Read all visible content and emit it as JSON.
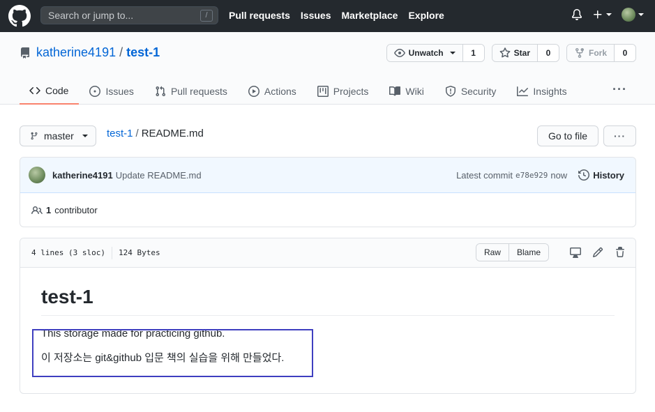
{
  "header": {
    "search_placeholder": "Search or jump to...",
    "search_shortcut": "/",
    "nav": [
      "Pull requests",
      "Issues",
      "Marketplace",
      "Explore"
    ]
  },
  "repo": {
    "owner": "katherine4191",
    "separator": "/",
    "name": "test-1",
    "watch": {
      "label": "Unwatch",
      "count": "1"
    },
    "star": {
      "label": "Star",
      "count": "0"
    },
    "fork": {
      "label": "Fork",
      "count": "0"
    },
    "tabs": [
      {
        "label": "Code",
        "icon": "code-icon",
        "selected": true
      },
      {
        "label": "Issues",
        "icon": "issue-icon"
      },
      {
        "label": "Pull requests",
        "icon": "pull-request-icon"
      },
      {
        "label": "Actions",
        "icon": "play-icon"
      },
      {
        "label": "Projects",
        "icon": "project-icon"
      },
      {
        "label": "Wiki",
        "icon": "book-icon"
      },
      {
        "label": "Security",
        "icon": "shield-icon"
      },
      {
        "label": "Insights",
        "icon": "graph-icon"
      }
    ]
  },
  "file_nav": {
    "branch": "master",
    "breadcrumb_repo": "test-1",
    "breadcrumb_sep": "/",
    "breadcrumb_file": "README.md",
    "goto_file": "Go to file",
    "more": "···"
  },
  "commit": {
    "author": "katherine4191",
    "message": "Update README.md",
    "latest_label": "Latest commit",
    "sha": "e78e929",
    "time": "now",
    "history": "History",
    "contributors_count": "1",
    "contributors_label": "contributor"
  },
  "file": {
    "lines": "4 lines (3 sloc)",
    "size": "124 Bytes",
    "raw": "Raw",
    "blame": "Blame"
  },
  "readme": {
    "title": "test-1",
    "line1": "This storage made for practicing github.",
    "line2": "이 저장소는 git&github 입문 책의 실습을 위해 만들었다."
  },
  "colors": {
    "header_bg": "#24292e",
    "link": "#0366d6",
    "selected_tab": "#f9826c",
    "highlight_box": "#3f3fc0"
  }
}
